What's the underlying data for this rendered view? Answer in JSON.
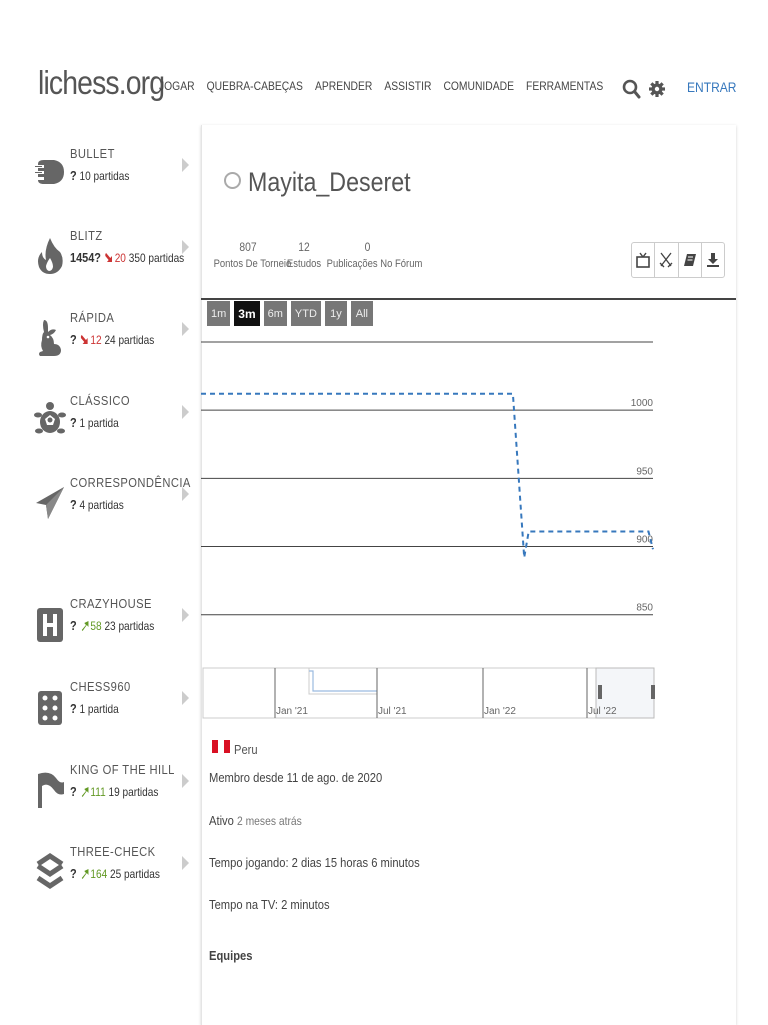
{
  "header": {
    "logo": "lichess.org",
    "nav": [
      "JOGAR",
      "QUEBRA-CABEÇAS",
      "APRENDER",
      "ASSISTIR",
      "COMUNIDADE",
      "FERRAMENTAS"
    ],
    "signin_label": "ENTRAR",
    "icons": {
      "search": "search-icon",
      "settings": "gear-icon"
    }
  },
  "sidebar": {
    "perfs": [
      {
        "name": "BULLET",
        "rating": "?",
        "progress": "",
        "direction": "none",
        "games": "10 partidas",
        "icon": "bullet-icon"
      },
      {
        "name": "BLITZ",
        "rating": "1454?",
        "progress": "20",
        "direction": "down",
        "games": "350 partidas",
        "icon": "flame-icon"
      },
      {
        "name": "RÁPIDA",
        "rating": "?",
        "progress": "12",
        "direction": "down",
        "games": "24 partidas",
        "icon": "rabbit-icon"
      },
      {
        "name": "CLÁSSICO",
        "rating": "?",
        "progress": "",
        "direction": "none",
        "games": "1 partida",
        "icon": "turtle-icon"
      },
      {
        "name": "CORRESPONDÊNCIA",
        "rating": "?",
        "progress": "",
        "direction": "none",
        "games": "4 partidas",
        "icon": "paper-plane-icon"
      },
      {
        "name": "CRAZYHOUSE",
        "rating": "?",
        "progress": "58",
        "direction": "up",
        "games": "23 partidas",
        "icon": "crazyhouse-icon"
      },
      {
        "name": "CHESS960",
        "rating": "?",
        "progress": "",
        "direction": "none",
        "games": "1 partida",
        "icon": "dice-icon"
      },
      {
        "name": "KING OF THE HILL",
        "rating": "?",
        "progress": "111",
        "direction": "up",
        "games": "19 partidas",
        "icon": "flag-icon"
      },
      {
        "name": "THREE-CHECK",
        "rating": "?",
        "progress": "164",
        "direction": "up",
        "games": "25 partidas",
        "icon": "three-check-icon"
      }
    ]
  },
  "profile": {
    "username": "Mayita_Deseret",
    "stats": [
      {
        "value": "807",
        "label": "Pontos De Torneio"
      },
      {
        "value": "12",
        "label": "Estudos"
      },
      {
        "value": "0",
        "label": "Publicações No Fórum"
      }
    ],
    "actions": [
      "tv-icon",
      "swords-icon",
      "book-icon",
      "download-icon"
    ],
    "country": "Peru",
    "member_since": "Membro desde 11 de ago. de 2020",
    "active_label": "Ativo",
    "active_value": "2 meses atrás",
    "play_time": "Tempo jogando: 2 dias 15 horas 6 minutos",
    "tv_time": "Tempo na TV: 2 minutos",
    "teams_label": "Equipes"
  },
  "ranges": [
    "1m",
    "3m",
    "6m",
    "YTD",
    "1y",
    "All"
  ],
  "selected_range": "3m",
  "chart_data": {
    "type": "line",
    "y_ticks": [
      1000,
      950,
      900,
      850
    ],
    "ylim": [
      830,
      1050
    ],
    "grid": true,
    "series": [
      {
        "style": "dashed",
        "color": "#3778bd",
        "points": [
          [
            0,
            1012
          ],
          [
            0.69,
            1012
          ],
          [
            0.715,
            892
          ],
          [
            0.725,
            911
          ],
          [
            0.99,
            911
          ],
          [
            1.0,
            898
          ]
        ]
      }
    ],
    "navigator_labels": [
      "Jan '21",
      "Jul '21",
      "Jan '22",
      "Jul '22"
    ]
  }
}
